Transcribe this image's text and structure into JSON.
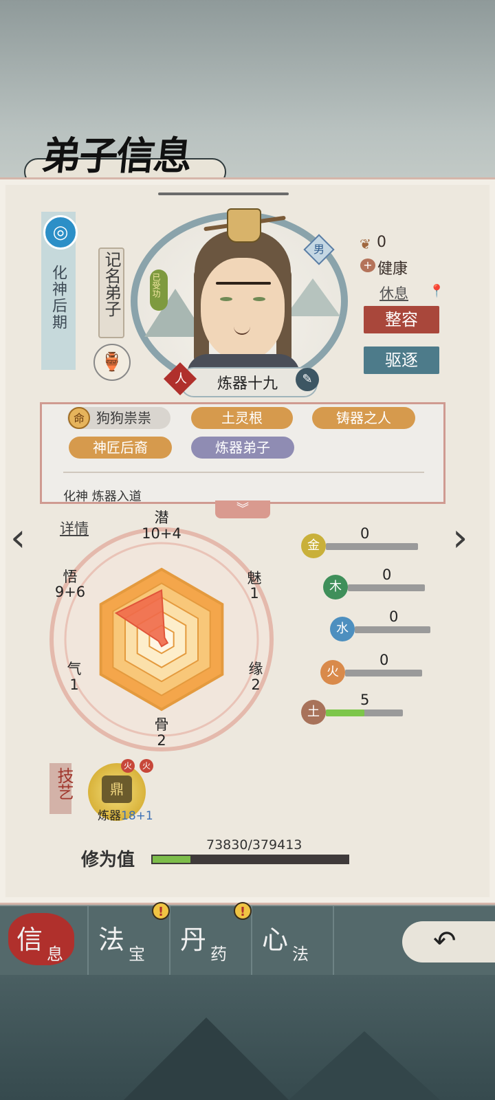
{
  "header": {
    "title": "弟子信息"
  },
  "disciple": {
    "realm": "化神后期",
    "rank": "记名弟子",
    "gender": "男",
    "cultivated_tag": "已受功",
    "race": "人",
    "name": "炼器十九"
  },
  "status": {
    "mood_value": "0",
    "health": "健康",
    "activity": "休息",
    "makeover_label": "整容",
    "expel_label": "驱逐"
  },
  "traits": [
    {
      "label": "狗狗祟祟",
      "icon": "命"
    },
    {
      "label": "土灵根"
    },
    {
      "label": "铸器之人"
    },
    {
      "label": "神匠后裔"
    },
    {
      "label": "炼器弟子"
    }
  ],
  "traits_row2_partial": "化神 炼器入道",
  "detail_link": "详情",
  "attributes": {
    "qian": {
      "name": "潜",
      "value": "10+4"
    },
    "mei": {
      "name": "魅",
      "value": "1"
    },
    "yuan": {
      "name": "缘",
      "value": "2"
    },
    "gu": {
      "name": "骨",
      "value": "2"
    },
    "qi": {
      "name": "气",
      "value": "1"
    },
    "wu": {
      "name": "悟",
      "value": "9+6"
    }
  },
  "radar_data": {
    "axes": [
      "潜",
      "魅",
      "缘",
      "骨",
      "气",
      "悟"
    ],
    "values": [
      14,
      1,
      2,
      2,
      1,
      15
    ],
    "max": 20
  },
  "elements": [
    {
      "name": "金",
      "value": "0",
      "fraction": 0,
      "color": "#c9b03a"
    },
    {
      "name": "木",
      "value": "0",
      "fraction": 0,
      "color": "#3f8f5a"
    },
    {
      "name": "水",
      "value": "0",
      "fraction": 0,
      "color": "#4d8fbf"
    },
    {
      "name": "火",
      "value": "0",
      "fraction": 0,
      "color": "#d98a4b"
    },
    {
      "name": "土",
      "value": "5",
      "fraction": 0.5,
      "color": "#a8725a"
    }
  ],
  "skills": {
    "label": "技艺",
    "items": [
      {
        "name": "炼器",
        "level": "18+1"
      }
    ]
  },
  "cultivation": {
    "label": "修为值",
    "current": 73830,
    "max": 379413,
    "text": "73830/379413"
  },
  "tabs": [
    {
      "big": "信",
      "small": "息",
      "active": true,
      "alert": false
    },
    {
      "big": "法",
      "small": "宝",
      "active": false,
      "alert": true
    },
    {
      "big": "丹",
      "small": "药",
      "active": false,
      "alert": true
    },
    {
      "big": "心",
      "small": "法",
      "active": false,
      "alert": false
    }
  ],
  "colors": {
    "accent_red": "#a9473b",
    "accent_teal": "#4d7b8a",
    "trait_gold": "#d69a4d",
    "trait_purple": "#8f8cb3",
    "radar_fill": "#f06a4a"
  }
}
